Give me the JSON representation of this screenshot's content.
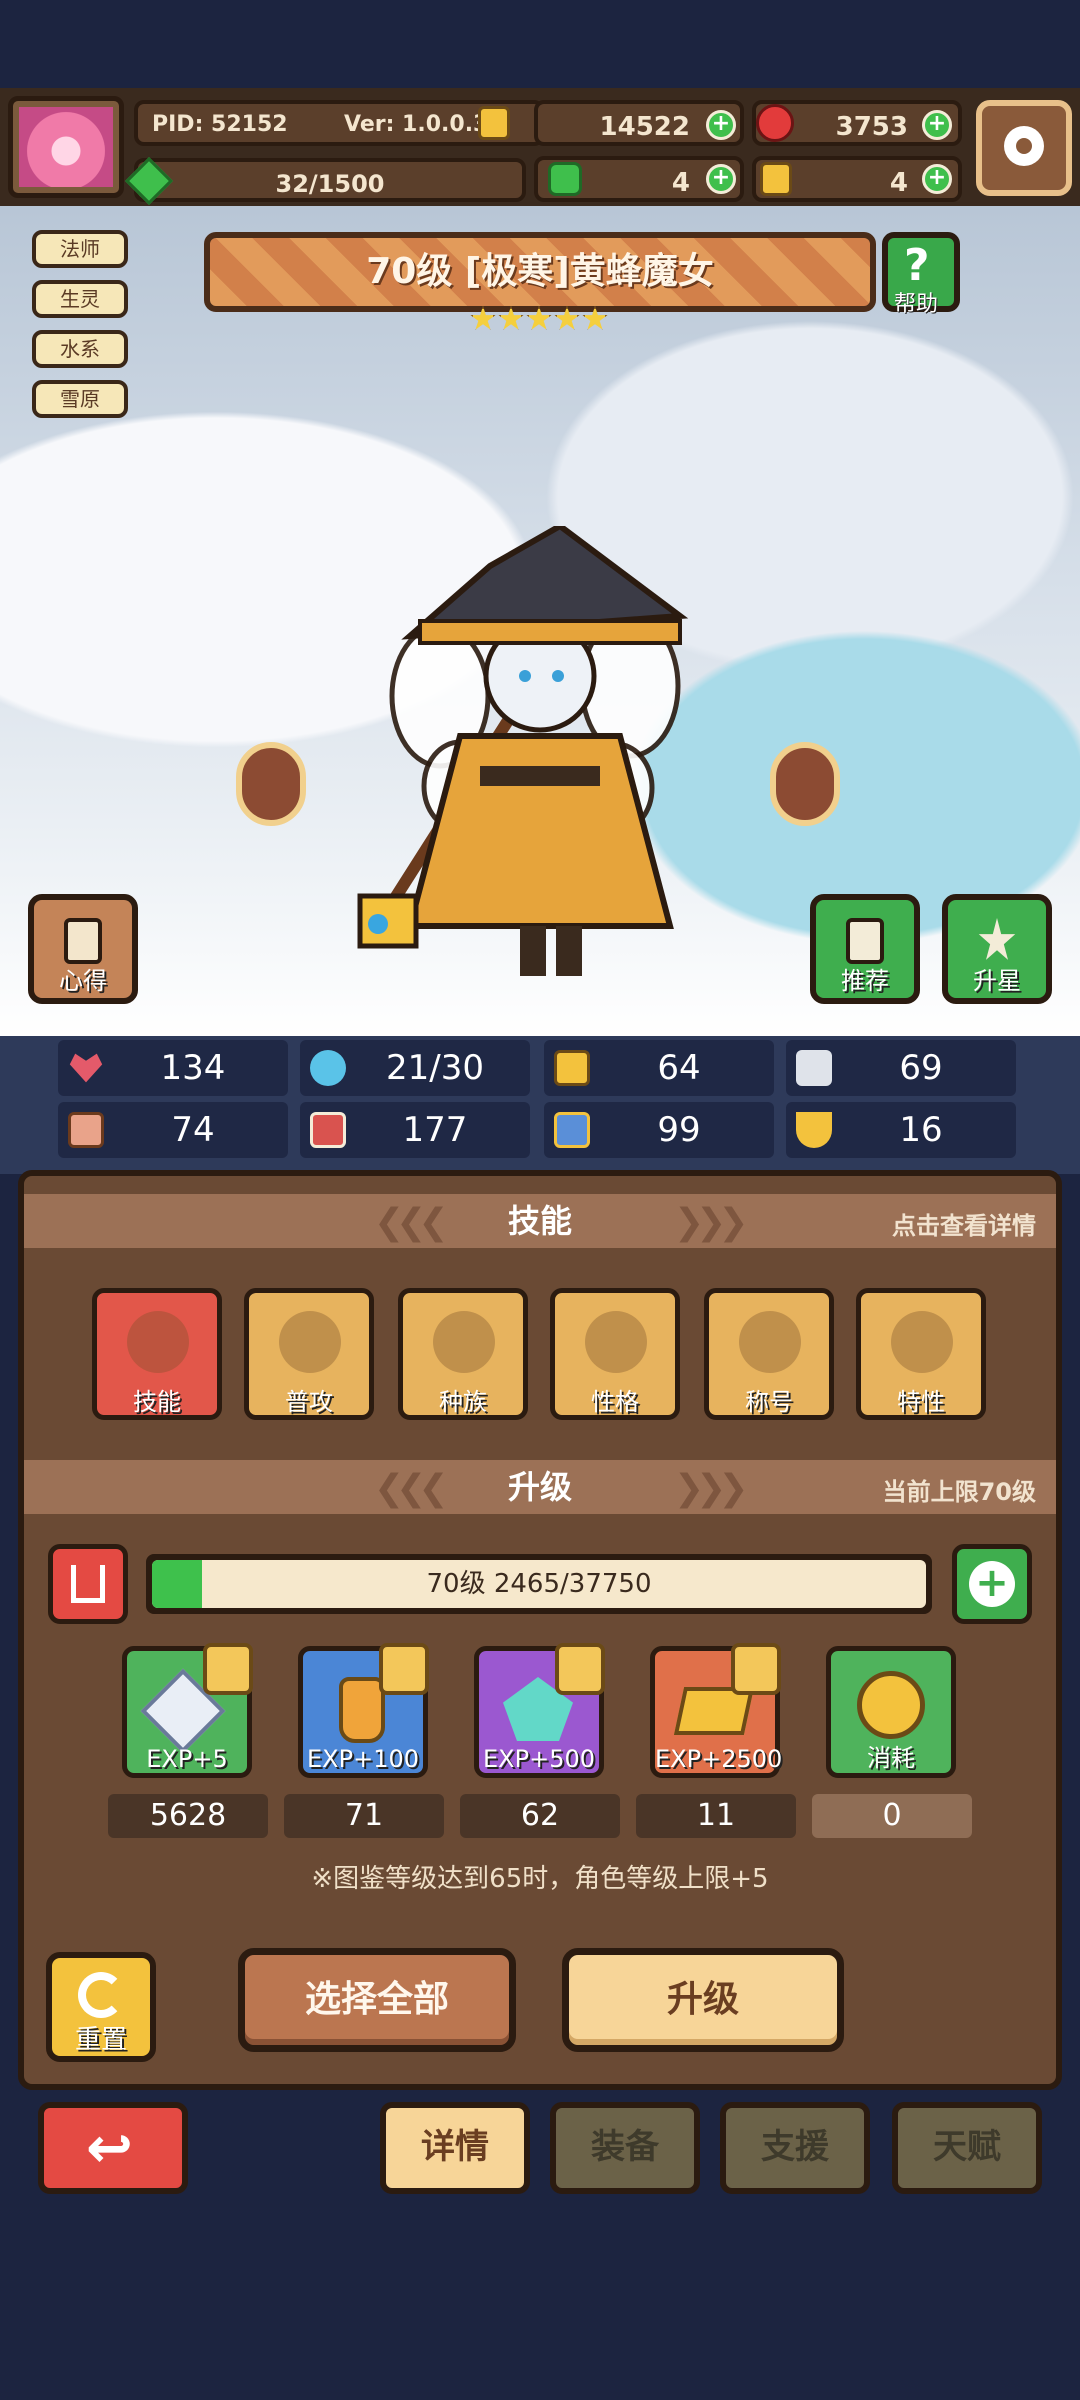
{
  "header": {
    "pid": "PID: 52152",
    "version": "Ver: 1.0.0.3",
    "energy": "32/1500",
    "gold": "14522",
    "gems": "3753",
    "clover": "4",
    "keys": "4"
  },
  "tags": [
    "法师",
    "生灵",
    "水系",
    "雪原"
  ],
  "character": {
    "title": "70级 [极寒]黄蜂魔女",
    "stars": 5,
    "help_label": "帮助",
    "left_button": "心得",
    "recommend_button": "推荐",
    "starup_button": "升星"
  },
  "stats": [
    "134",
    "21/30",
    "64",
    "69",
    "74",
    "177",
    "99",
    "16"
  ],
  "skills_section": {
    "title": "技能",
    "hint": "点击查看详情",
    "items": [
      "技能",
      "普攻",
      "种族",
      "性格",
      "称号",
      "特性"
    ]
  },
  "upgrade_section": {
    "title": "升级",
    "hint": "当前上限70级",
    "level_text": "70级 2465/37750",
    "progress_fraction": 0.065,
    "items": [
      {
        "label": "EXP+5",
        "count": "5628"
      },
      {
        "label": "EXP+100",
        "count": "71"
      },
      {
        "label": "EXP+500",
        "count": "62"
      },
      {
        "label": "EXP+2500",
        "count": "11"
      },
      {
        "label": "消耗",
        "count": "0"
      }
    ],
    "note": "※图鉴等级达到65时，角色等级上限+5"
  },
  "actions": {
    "reset": "重置",
    "select_all": "选择全部",
    "upgrade": "升级"
  },
  "tabs": [
    "详情",
    "装备",
    "支援",
    "天赋"
  ],
  "colors": {
    "panel": "#6a4a34",
    "accent_green": "#3ec14c",
    "accent_red": "#e44a43",
    "tab_active": "#f7d598"
  }
}
